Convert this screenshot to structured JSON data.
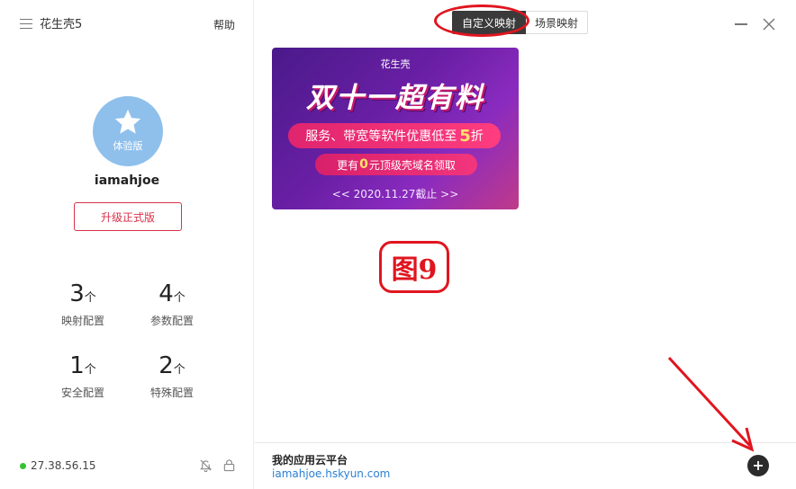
{
  "app": {
    "title": "花生壳5",
    "help_label": "帮助"
  },
  "user": {
    "avatar_badge": "体验版",
    "username": "iamahjoe",
    "upgrade_label": "升级正式版"
  },
  "stats": [
    {
      "value": "3",
      "unit": "个",
      "label": "映射配置"
    },
    {
      "value": "4",
      "unit": "个",
      "label": "参数配置"
    },
    {
      "value": "1",
      "unit": "个",
      "label": "安全配置"
    },
    {
      "value": "2",
      "unit": "个",
      "label": "特殊配置"
    }
  ],
  "status": {
    "ip": "27.38.56.15",
    "online_color": "#33c233"
  },
  "tabs": [
    {
      "label": "自定义映射",
      "active": true
    },
    {
      "label": "场景映射",
      "active": false
    }
  ],
  "banner": {
    "brand": "花生壳",
    "headline": "双十一超有料",
    "line1_prefix": "服务、带宽等软件优惠低至",
    "line1_number": "5",
    "line1_suffix": "折",
    "line2_prefix": "更有",
    "line2_number": "0",
    "line2_suffix": "元顶级壳域名领取",
    "date": "<< 2020.11.27截止 >>"
  },
  "annotation": {
    "figure_label": "图9",
    "color": "#e0151f"
  },
  "cloud": {
    "title": "我的应用云平台",
    "link": "iamahjoe.hskyun.com"
  },
  "icons": [
    "menu-icon",
    "star-icon",
    "bell-off-icon",
    "lock-icon",
    "minimize-icon",
    "close-icon",
    "plus-icon"
  ]
}
